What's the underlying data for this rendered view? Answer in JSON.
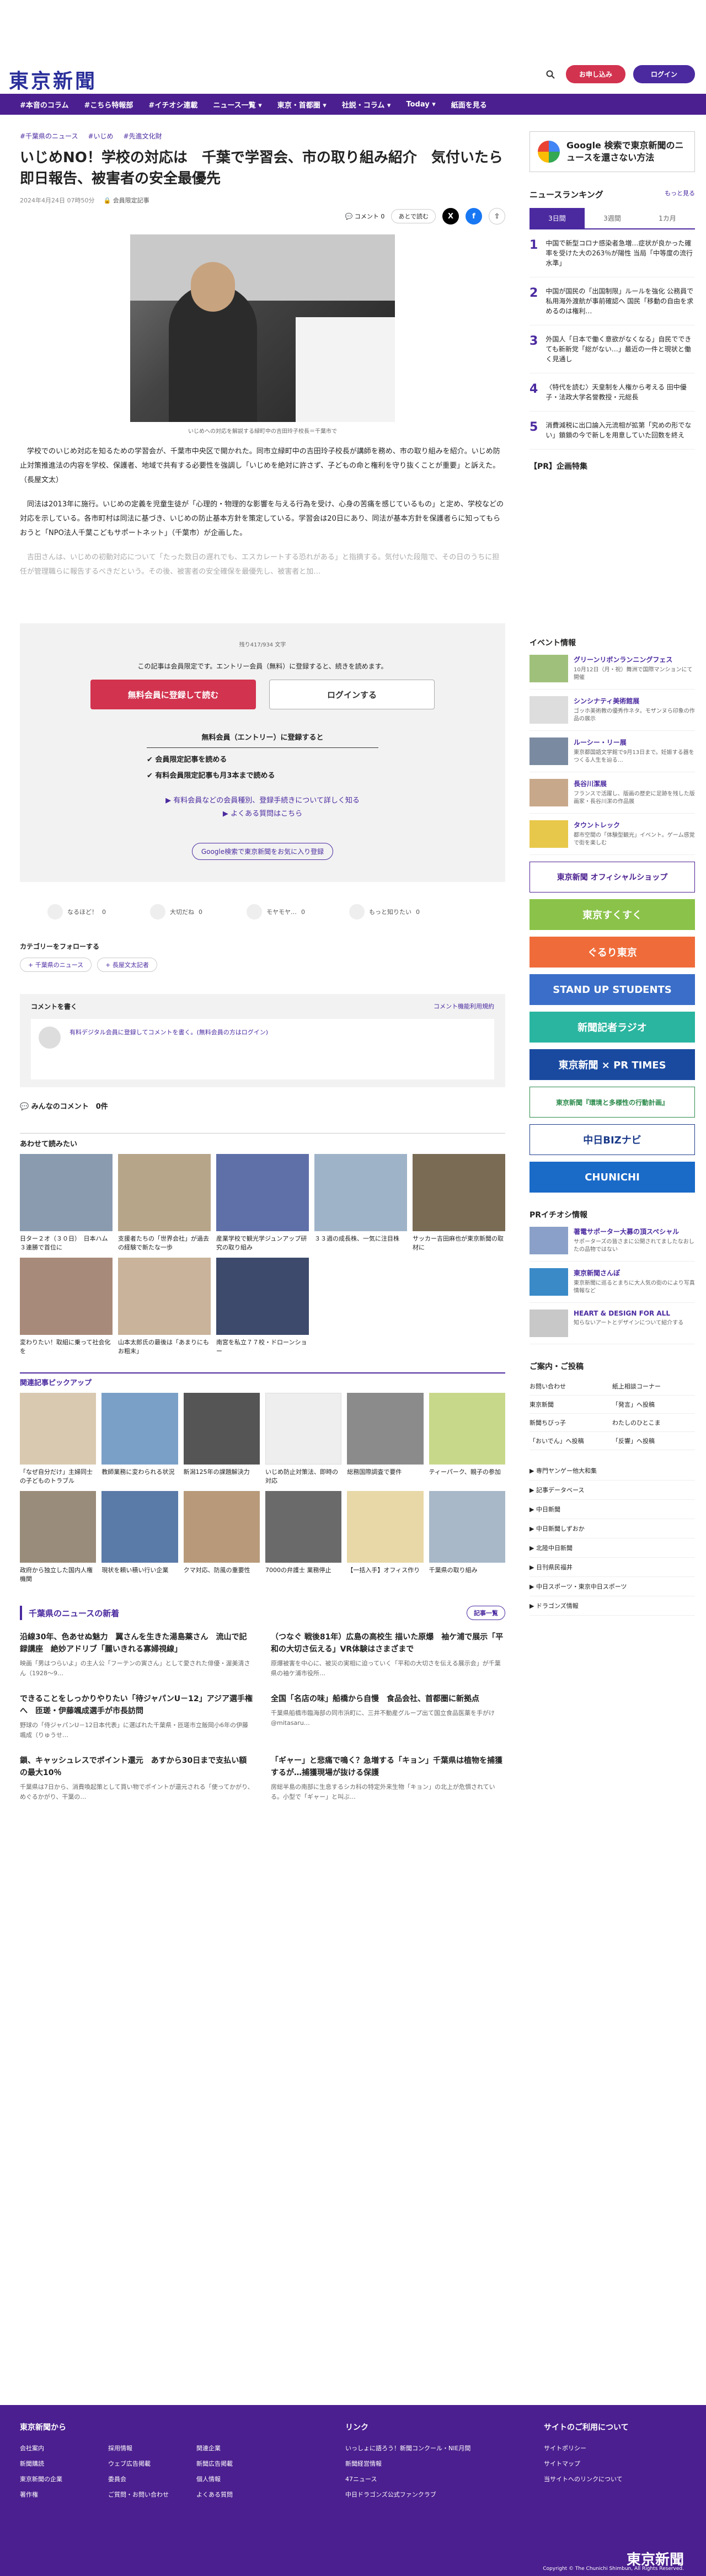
{
  "header": {
    "logo": "東京新聞",
    "register": "お申し込み",
    "login": "ログイン"
  },
  "nav": [
    "#本音のコラム",
    "#こちら特報部",
    "#イチオシ連載",
    "ニュース一覧 ▾",
    "東京・首都圏 ▾",
    "社説・コラム ▾",
    "Today ▾",
    "紙面を見る"
  ],
  "article": {
    "tags": [
      "#千葉県のニュース",
      "#いじめ",
      "#先進文化財"
    ],
    "title": "いじめNO！学校の対応は　千葉で学習会、市の取り組み紹介　気付いたら即日報告、被害者の安全最優先",
    "date": "2024年4月24日 07時50分",
    "member": "会員限定記事",
    "comment_label": "コメント",
    "comment_count": "0",
    "bookmark": "あとで読む",
    "caption": "いじめへの対応を解説する緑町中の吉田玲子校長＝千葉市で",
    "p1": "学校でのいじめ対応を知るための学習会が、千葉市中央区で開かれた。同市立緑町中の吉田玲子校長が講師を務め、市の取り組みを紹介。いじめ防止対策推進法の内容を学校、保護者、地域で共有する必要性を強調し「いじめを絶対に許さず、子どもの命と権利を守り抜くことが重要」と訴えた。（長屋文太）",
    "p2": "同法は2013年に施行。いじめの定義を児童生徒が「心理的・物理的な影響を与える行為を受け、心身の苦痛を感じているもの」と定め、学校などの対応を示している。各市町村は同法に基づき、いじめの防止基本方針を策定している。学習会は20日にあり、同法が基本方針を保護者らに知ってもらおうと「NPO法人千葉こどもサポートネット」（千葉市）が企画した。",
    "p3": "吉田さんは、いじめの初動対応について「たった数日の遅れでも、エスカレートする恐れがある」と指摘する。気付いた段階で、その日のうちに担任が管理職らに報告するべきだという。その後、被害者の安全確保を最優先し、被害者と加…"
  },
  "paywall": {
    "count": "残り417/934 文字",
    "msg": "この記事は会員限定です。エントリー会員（無料）に登録すると、続きを読めます。",
    "register": "無料会員に登録して読む",
    "login": "ログインする",
    "box_title": "無料会員（エントリー）に登録すると",
    "items": [
      "会員限定記事を読める",
      "有料会員限定記事も月3本まで読める"
    ],
    "links": [
      "有料会員などの会員種別、登録手続きについて詳しく知る",
      "よくある質問はこちら"
    ],
    "google": "Google検索で東京新聞をお気に入り登録"
  },
  "reactions": [
    {
      "label": "なるほど！",
      "n": "0"
    },
    {
      "label": "大切だね",
      "n": "0"
    },
    {
      "label": "モヤモヤ…",
      "n": "0"
    },
    {
      "label": "もっと知りたい",
      "n": "0"
    }
  ],
  "follow": {
    "title": "カテゴリーをフォローする",
    "tags": [
      "+ 千葉県のニュース",
      "+ 長屋文太記者"
    ]
  },
  "comments": {
    "title": "コメントを書く",
    "rules": "コメント機能利用規約",
    "prompt": "有料デジタル会員に登録してコメントを書く。(無料会員の方はログイン)",
    "count_label": "みんなのコメント",
    "count": "0件"
  },
  "recs": {
    "title": "あわせて読みたい",
    "items": [
      "日ター２オ（３０日）　日本ハム３連勝で首位に",
      "支援者たちの「世界会社」が過去の経験で新たな一歩",
      "産業学校で観光学ジュンアップ研究の取り組み",
      "３３週の成長株、一気に注目株",
      "サッカー吉田麻也が東京新聞の取材に",
      "変わりたい！取組に乗って社会化を",
      "山本太郎氏の最後は「あまりにもお粗末」",
      "南宮を私立７７校・ドローンショー"
    ]
  },
  "pickup": {
    "title": "関連記事ピックアップ",
    "items": [
      "「なぜ自分だけ」主婦同士の子どものトラブル",
      "教師業務に変わられる状況",
      "新潟125年の課題解決力",
      "いじめ防止対策法、即時の対応",
      "総務国際調査で要件",
      "ティーパーク、親子の参加",
      "政府から独立した国内人権機関",
      "現状を頼い積い行い企業",
      "クマ対応、防風の重要性",
      "7000の弁護士 業務停止",
      "【一括入手】オフィス作り",
      "千葉県の取り組み"
    ]
  },
  "chiba": {
    "title": "千葉県のニュースの新着",
    "more": "記事一覧",
    "items": [
      {
        "t": "沿線30年、色あせぬ魅力　翼さんを生きた湯島薬さん　流山で記録講座　絶妙アドリブ「麗いきれる寡婦視線」",
        "d": "映画「男はつらいよ」の主人公「フーテンの寅さん」として愛された俳優・渥美清さん（1928～9…"
      },
      {
        "t": "（つなぐ 戦後81年）広島の高校生 描いた原爆　袖ケ浦で展示「平和の大切さ伝える」VR体験はさまざまで",
        "d": "原爆被害を中心に、被災の実相に迫っていく「平和の大切さを伝える展示会」が千葉県の袖ケ浦市役所…"
      },
      {
        "t": "できることをしっかりやりたい「待ジャパンU－12」アジア選手権へ　匝瑳・伊藤颯成選手が市長訪問",
        "d": "野球の「侍ジャパンU－12日本代表」に選ばれた千葉県・匝瑳市立飯岡小6年の伊藤颯成（りゅうせ…"
      },
      {
        "t": "全国「名店の味」船橋から自慢　食品会社、首都圏に新拠点",
        "d": "千葉県船橋市臨海部の同市浜町に、三井不動産グループ出て国立食品医薬を手がけ@mitasaru…"
      },
      {
        "t": "鎖、キャッシュレスでポイント還元　あすから30日まで支払い額の最大10％",
        "d": "千葉県は7日から、消費喚起策として買い物でポイントが還元される「使ってかがり、めぐるかがり、干葉の…"
      },
      {
        "t": "「ギャー」と悲痛で鳴く？急増する「キョン」千葉県は植物を捕獲するが…捕獲現場が抜ける保護",
        "d": "房総半島の南部に生息するシカ科の特定外来生物「キョン」の北上が危惧されている。小型で「ギャー」と叫ぶ…"
      }
    ]
  },
  "side": {
    "google_box": "Google 検索で東京新聞のニュースを還さない方法",
    "ranking_title": "ニュースランキング",
    "ranking_more": "もっと見る",
    "ranking_tabs": [
      "3日間",
      "3週間",
      "1カ月"
    ],
    "ranking": [
      {
        "n": "1",
        "t": "中国で新型コロナ感染者急増…症状が良かった確率を受けた大の263％が陽性 当局「中等度の流行水準」"
      },
      {
        "n": "2",
        "t": "中国が国民の「出国制限」ルールを強化 公務員で私用海外渡航が事前確認へ 国民「移動の自由を求めるのは権利…"
      },
      {
        "n": "3",
        "t": "外国人「日本で働く意欲がなくなる」自民でできても新新党「総がない…」最近の一件と現状と働く見通し"
      },
      {
        "n": "4",
        "t": "〈特代を読む〉天皇制を人権から考える 田中優子・法政大学名誉教授・元総長"
      },
      {
        "n": "5",
        "t": "消費減税に出口論入元流相が拡第「究めの形でない」鎖鎖の今で新しを用意していた回数を終え"
      }
    ],
    "pr": "【PR】企画特集",
    "events_title": "イベント情報",
    "events": [
      {
        "t": "グリーンリボンランニングフェス",
        "d": "10月12日（月・祝）舞洲で国際マンションにて開催"
      },
      {
        "t": "シンシナティ美術館展",
        "d": "ゴッホ美術教の優秀作ネタ。モザンヌら印象の作品の展示"
      },
      {
        "t": "ルーシー・リー展",
        "d": "東京都国語文学館で9月13日まで。妊娠する器をつくる人生を辿る…"
      },
      {
        "t": "長谷川潔展",
        "d": "フランスで活躍し、版画の歴史に足跡を残した版画家・長谷川潔の作品展"
      },
      {
        "t": "タウントレック",
        "d": "都市空間の「体験型観光」イベント。ゲーム感覚で街を楽しむ"
      }
    ],
    "banners": [
      "東京新聞 オフィシャルショップ",
      "東京すくすく",
      "ぐるり東京",
      "STAND UP STUDENTS",
      "新聞記者ラジオ",
      "東京新聞 × PR TIMES",
      "東京新聞『環境と多様性の行動計画』",
      "中日BIZナビ",
      "CHUNICHI"
    ],
    "pr_title": "PRイチオシ情報",
    "pr_items": [
      {
        "t": "著電サポーター大募の頂スペシャル",
        "d": "サポーターズの皆さまに公開されてましたなおしたの品物ではない"
      },
      {
        "t": "東京新聞さんぽ",
        "d": "東京新聞に巡るとまちに大人気の街のにより写真情報など"
      },
      {
        "t": "HEART & DESIGN FOR ALL",
        "d": "知らないアートとデザインについて紹介する"
      }
    ],
    "guide_title": "ご案内・ご投稿",
    "guide": [
      "お問い合わせ",
      "紙上相談コーナー",
      "東京新聞",
      "「発言」へ投稿",
      "新聞ちびっ子",
      "わたしのひとこま",
      "「おいでん」へ投稿",
      "「反響」へ投稿"
    ],
    "services": [
      "専門ヤンゲー他大和集",
      "記事データベース",
      "中日新聞",
      "中日新聞しずおか",
      "北陸中日新聞",
      "日刊県民福井",
      "中日スポーツ・東京中日スポーツ",
      "ドラゴンズ情報"
    ]
  },
  "footer": {
    "col1_title": "東京新聞から",
    "col1": [
      "会社案内",
      "採用情報",
      "関連企業",
      "新聞購読",
      "ウェブ広告掲載",
      "新聞広告掲載",
      "東京新聞の企業",
      "委員会",
      "個人情報",
      "著作権",
      "ご質問・お問い合わせ",
      "よくある質問"
    ],
    "col2_title": "リンク",
    "col2": [
      "いっしょに語ろう！新聞コンクール・NIE月間",
      "新聞経営情報",
      "47ニュース",
      "中日ドラゴンズ公式ファンクラブ"
    ],
    "col3_title": "サイトのご利用について",
    "col3": [
      "サイトポリシー",
      "サイトマップ",
      "当サイトへのリンクについて"
    ],
    "logo": "東京新聞",
    "copyright": "Copyright © The Chunichi Shimbun, All Rights Reserved."
  },
  "colors": {
    "brand": "#4b1f8f",
    "accent": "#d2334f",
    "link": "#4b2aa0"
  }
}
